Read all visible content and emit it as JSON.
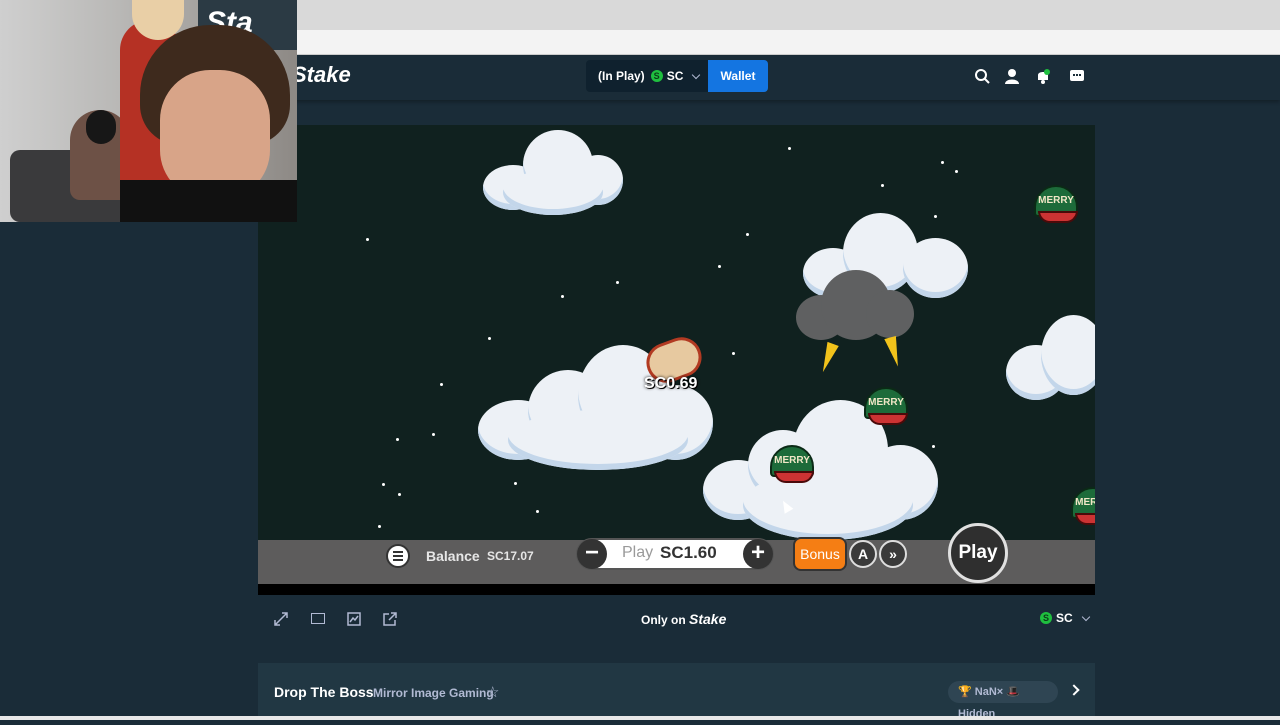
{
  "header": {
    "logo": "Stake",
    "in_play_label": "(In Play)",
    "currency": "SC",
    "wallet_button": "Wallet"
  },
  "game": {
    "win_amount": "SC0.69",
    "cap_text": "MERRY",
    "controls": {
      "balance_label": "Balance",
      "balance_value": "SC17.07",
      "bet_prefix": "Play",
      "bet_value": "SC1.60",
      "minus": "−",
      "plus": "+",
      "bonus_button": "Bonus",
      "auto_icon": "A",
      "turbo_icon": "»",
      "play_button": "Play"
    }
  },
  "footer": {
    "only_on": "Only on",
    "only_on_brand": "Stake",
    "currency": "SC"
  },
  "info": {
    "game_title": "Drop The Boss",
    "provider": "Mirror Image Gaming",
    "stats": "🏆 NaN×  🎩 Hidden"
  },
  "webcam": {
    "logo_fragment": "Sta"
  },
  "colors": {
    "wallet_blue": "#1475e1",
    "bonus_orange": "#f57e14",
    "coin_green": "#1fbf3f",
    "bg": "#1a2c38"
  }
}
